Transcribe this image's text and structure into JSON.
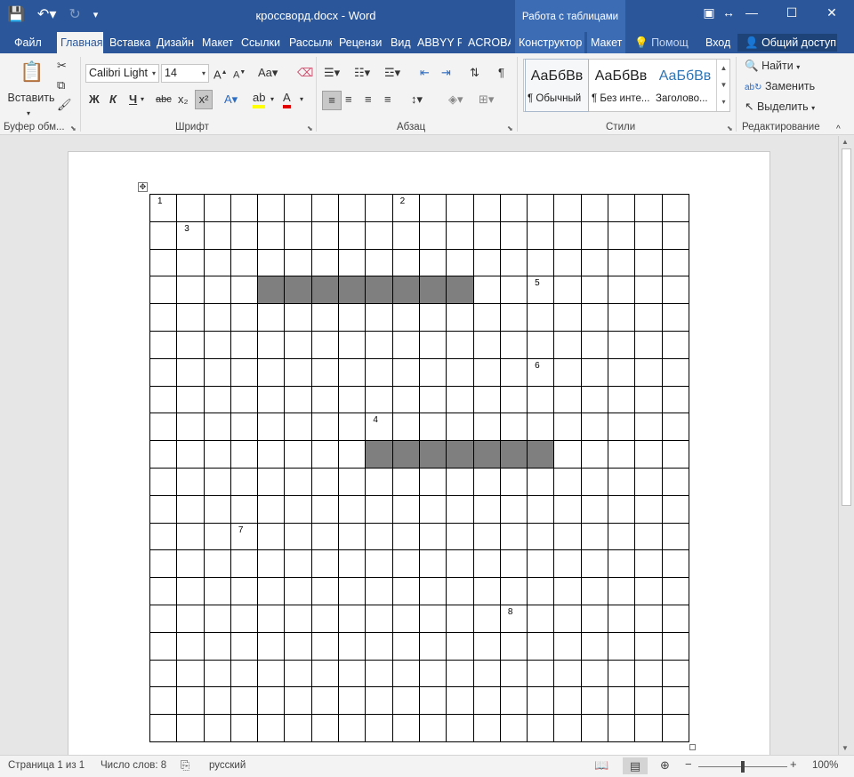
{
  "titlebar": {
    "document_title": "кроссворд.docx - Word",
    "context_tab_group": "Работа с таблицами"
  },
  "tabs": [
    "Файл",
    "Главная",
    "Вставка",
    "Дизайн",
    "Макет",
    "Ссылки",
    "Рассылк",
    "Рецензи",
    "Вид",
    "ABBYY Fi",
    "ACROBA",
    "Конструктор",
    "Макет"
  ],
  "tell_me": "Помощ",
  "signin": "Вход",
  "share": "Общий доступ",
  "ribbon": {
    "clipboard": {
      "paste_label": "Вставить",
      "group_label": "Буфер обм..."
    },
    "font": {
      "name": "Calibri Light",
      "size": "14",
      "group_label": "Шрифт",
      "bold": "Ж",
      "italic": "К",
      "underline": "Ч",
      "strike": "abc",
      "subscript": "x₂",
      "superscript": "x²"
    },
    "paragraph": {
      "group_label": "Абзац"
    },
    "styles": {
      "group_label": "Стили",
      "items": [
        {
          "preview": "АаБбВв",
          "name": "¶ Обычный"
        },
        {
          "preview": "АаБбВв",
          "name": "¶ Без инте..."
        },
        {
          "preview": "АаБбВв",
          "name": "Заголово..."
        }
      ]
    },
    "editing": {
      "group_label": "Редактирование",
      "find": "Найти",
      "replace": "Заменить",
      "select": "Выделить"
    }
  },
  "crossword": {
    "rows": 20,
    "cols": 20,
    "numbers": [
      {
        "n": "1",
        "row": 0,
        "col": 0
      },
      {
        "n": "2",
        "row": 0,
        "col": 9
      },
      {
        "n": "3",
        "row": 1,
        "col": 1
      },
      {
        "n": "5",
        "row": 3,
        "col": 14
      },
      {
        "n": "6",
        "row": 6,
        "col": 14
      },
      {
        "n": "4",
        "row": 8,
        "col": 8
      },
      {
        "n": "7",
        "row": 12,
        "col": 3
      },
      {
        "n": "8",
        "row": 15,
        "col": 13
      }
    ],
    "shaded": [
      {
        "row": 3,
        "from": 4,
        "to": 11
      },
      {
        "row": 9,
        "from": 8,
        "to": 14
      }
    ]
  },
  "statusbar": {
    "page": "Страница 1 из 1",
    "words": "Число слов: 8",
    "language": "русский",
    "zoom": "100%"
  }
}
